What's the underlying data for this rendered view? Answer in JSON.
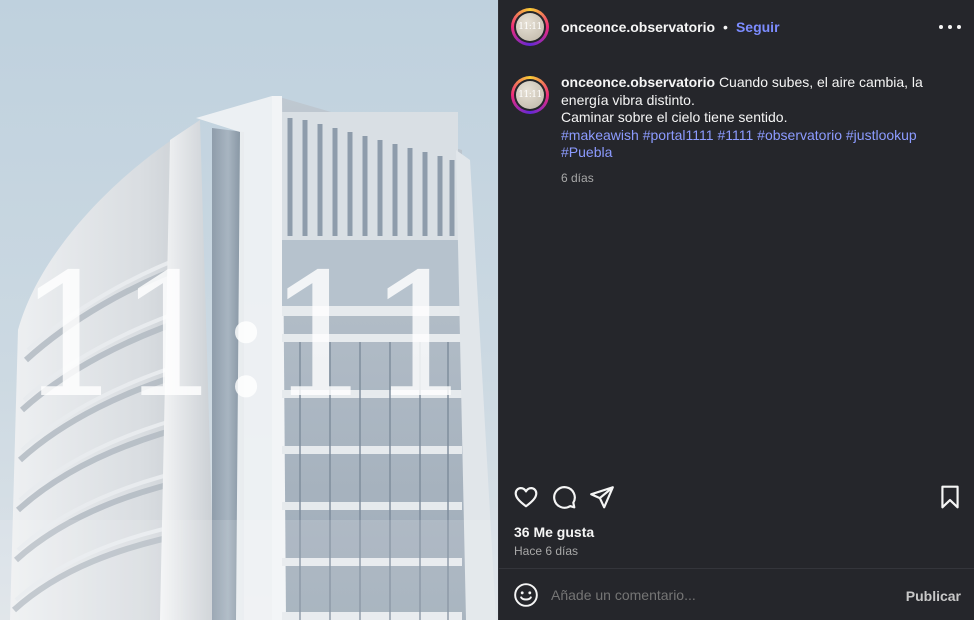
{
  "post": {
    "username": "onceonce.observatorio",
    "dot": "•",
    "follow_label": "Seguir",
    "avatar_text": "11:11",
    "image_overlay_text": "11:11",
    "caption_user": "onceonce.observatorio",
    "caption_line1": "Cuando subes, el aire cambia, la energía vibra distinto.",
    "caption_line2": "Caminar sobre el cielo tiene sentido.",
    "hashtags": [
      "#makeawish",
      "#portal1111",
      "#1111",
      "#observatorio",
      "#justlookup",
      "#Puebla"
    ],
    "caption_time": "6 días",
    "likes": "36 Me gusta",
    "ago": "Hace 6 días"
  },
  "actions": {
    "like_icon": "heart-icon",
    "comment_icon": "comment-icon",
    "share_icon": "paper-plane-icon",
    "save_icon": "bookmark-icon",
    "more_icon": "more-horizontal-icon"
  },
  "comment_bar": {
    "emoji_icon": "smiley-icon",
    "placeholder": "Añade un comentario...",
    "publish_label": "Publicar"
  },
  "colors": {
    "panel_bg": "#25262b",
    "link": "#7c8cff",
    "hashtag": "#8c9bff",
    "muted": "#a8a8a8"
  }
}
